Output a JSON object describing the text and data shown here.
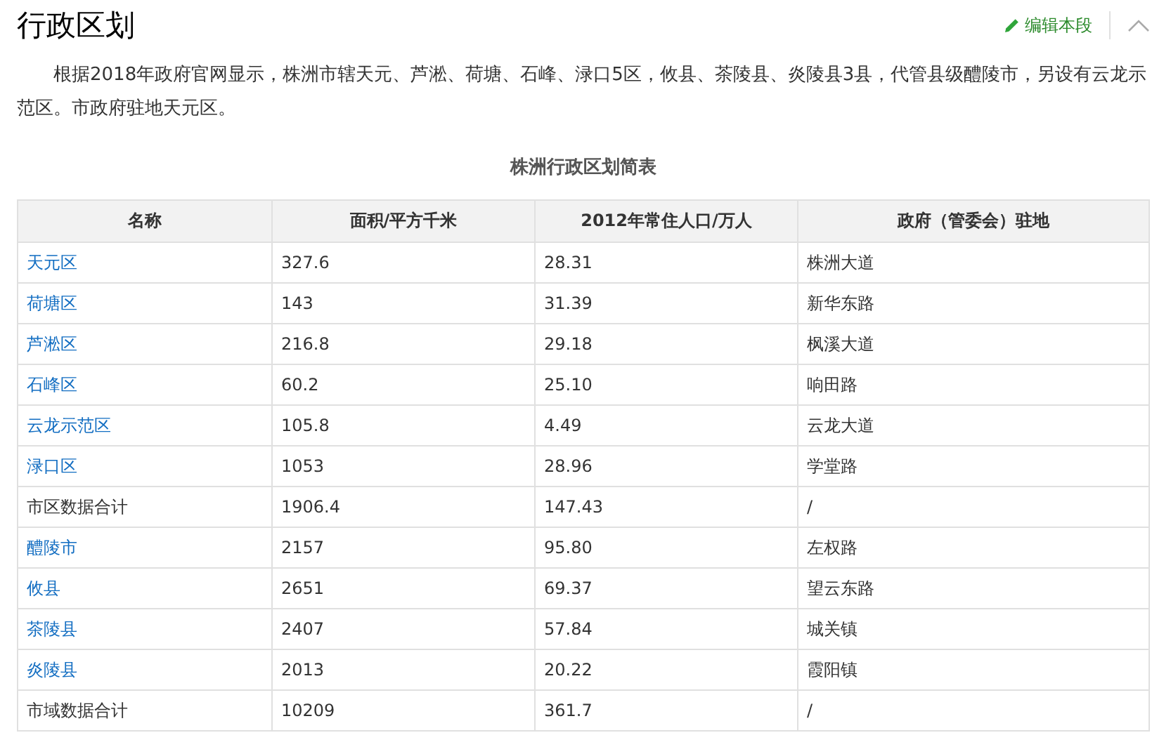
{
  "heading": "行政区划",
  "edit_link": "编辑本段",
  "paragraph": "根据2018年政府官网显示，株洲市辖天元、芦淞、荷塘、石峰、渌口5区，攸县、茶陵县、炎陵县3县，代管县级醴陵市，另设有云龙示范区。市政府驻地天元区。",
  "table": {
    "caption": "株洲行政区划简表",
    "columns": [
      "名称",
      "面积/平方千米",
      "2012年常住人口/万人",
      "政府（管委会）驻地"
    ],
    "rows": [
      {
        "cells": [
          "天元区",
          "327.6",
          "28.31",
          "株洲大道"
        ],
        "link": true
      },
      {
        "cells": [
          "荷塘区",
          "143",
          "31.39",
          "新华东路"
        ],
        "link": true
      },
      {
        "cells": [
          "芦淞区",
          "216.8",
          "29.18",
          "枫溪大道"
        ],
        "link": true
      },
      {
        "cells": [
          "石峰区",
          "60.2",
          "25.10",
          "响田路"
        ],
        "link": true
      },
      {
        "cells": [
          "云龙示范区",
          "105.8",
          "4.49",
          "云龙大道"
        ],
        "link": true
      },
      {
        "cells": [
          "渌口区",
          "1053",
          "28.96",
          "学堂路"
        ],
        "link": true
      },
      {
        "cells": [
          "市区数据合计",
          "1906.4",
          "147.43",
          "/"
        ],
        "link": false
      },
      {
        "cells": [
          "醴陵市",
          "2157",
          "95.80",
          "左权路"
        ],
        "link": true
      },
      {
        "cells": [
          "攸县",
          "2651",
          "69.37",
          "望云东路"
        ],
        "link": true
      },
      {
        "cells": [
          "茶陵县",
          "2407",
          "57.84",
          "城关镇"
        ],
        "link": true
      },
      {
        "cells": [
          "炎陵县",
          "2013",
          "20.22",
          "霞阳镇"
        ],
        "link": true
      },
      {
        "cells": [
          "市域数据合计",
          "10209",
          "361.7",
          "/"
        ],
        "link": false
      }
    ]
  }
}
